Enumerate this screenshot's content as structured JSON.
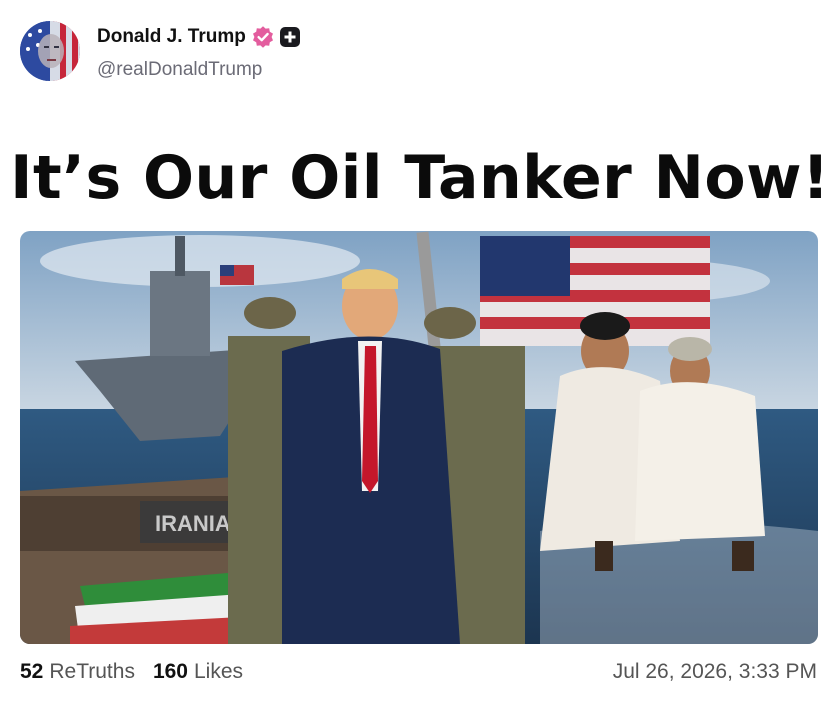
{
  "post": {
    "author_name": "Donald J. Trump",
    "author_handle": "@realDonaldTrump",
    "avatar_icon": "flag-portrait-avatar",
    "verified_icon": "verified-badge-icon",
    "verified_color": "#e35d9e",
    "extra_icon": "plus-badge-icon",
    "headline": "It’s Our Oil Tanker Now!",
    "image_ship_label": "IRANIA",
    "retruths_count": "52",
    "retruths_label": "ReTruths",
    "likes_count": "160",
    "likes_label": "Likes",
    "timestamp": "Jul 26, 2026, 3:33 PM"
  }
}
